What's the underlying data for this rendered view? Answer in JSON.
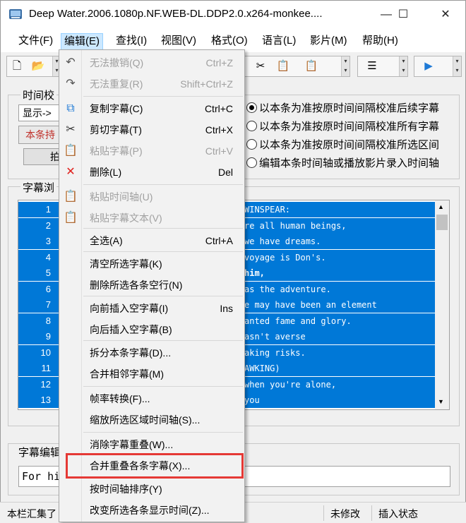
{
  "window": {
    "title": "Deep Water.2006.1080p.NF.WEB-DL.DDP2.0.x264-monkee....",
    "minimize_glyph": "—",
    "maximize_glyph": "☐",
    "close_glyph": "✕"
  },
  "menubar": {
    "items": [
      "文件(F)",
      "编辑(E)",
      "查找(I)",
      "视图(V)",
      "格式(O)",
      "语言(L)",
      "影片(M)",
      "帮助(H)"
    ]
  },
  "left_panel": {
    "group_label": "时间校",
    "display_button": "显示->",
    "red_button": "本条持",
    "small_button": "拍"
  },
  "radios": [
    {
      "label": "以本条为准按原时间间隔校准后续字幕",
      "checked": true
    },
    {
      "label": "以本条为准按原时间间隔校准所有字幕",
      "checked": false
    },
    {
      "label": "以本条为准按原时间间隔校准所选区间",
      "checked": false
    },
    {
      "label": "编辑本条时间轴或播放影片录入时间轴",
      "checked": false
    }
  ],
  "subtitle_browser": {
    "label": "字幕浏",
    "rows": [
      {
        "num": "1",
        "text": "WINSPEAR:",
        "bold": false
      },
      {
        "num": "2",
        "text": "re all human beings,",
        "bold": false
      },
      {
        "num": "3",
        "text": "we have dreams.",
        "bold": false
      },
      {
        "num": "4",
        "text": " voyage is Don's.",
        "bold": false
      },
      {
        "num": "5",
        "text": " him,",
        "bold": true
      },
      {
        "num": "6",
        "text": "as the adventure.",
        "bold": false
      },
      {
        "num": "7",
        "text": "e may have been an element",
        "bold": false
      },
      {
        "num": "8",
        "text": "anted fame and glory.",
        "bold": false
      },
      {
        "num": "9",
        "text": "asn't averse",
        "bold": false
      },
      {
        "num": "10",
        "text": "aking risks.",
        "bold": false
      },
      {
        "num": "11",
        "text": "AWKING)",
        "bold": false
      },
      {
        "num": "12",
        "text": " when you're alone,",
        "bold": false
      },
      {
        "num": "13",
        "text": " you",
        "bold": false
      }
    ]
  },
  "editor": {
    "label": "字幕编辑",
    "text": "For hi"
  },
  "statusbar": {
    "left": "本栏汇集了",
    "modified": "未修改",
    "mode": "插入状态"
  },
  "edit_menu": {
    "items": [
      {
        "label": "无法撤销(Q)",
        "shortcut": "Ctrl+Z",
        "disabled": true,
        "icon": "undo-icon"
      },
      {
        "label": "无法重复(R)",
        "shortcut": "Shift+Ctrl+Z",
        "disabled": true,
        "icon": "redo-icon"
      },
      {
        "label": "复制字幕(C)",
        "shortcut": "Ctrl+C",
        "disabled": false,
        "icon": "copy-icon"
      },
      {
        "label": "剪切字幕(T)",
        "shortcut": "Ctrl+X",
        "disabled": false,
        "icon": "cut-icon"
      },
      {
        "label": "粘贴字幕(P)",
        "shortcut": "Ctrl+V",
        "disabled": true,
        "icon": "paste-icon"
      },
      {
        "label": "删除(L)",
        "shortcut": "Del",
        "disabled": false,
        "icon": "delete-icon"
      },
      {
        "label": "粘贴时间轴(U)",
        "shortcut": "",
        "disabled": true,
        "icon": "paste-timeline-icon"
      },
      {
        "label": "粘贴字幕文本(V)",
        "shortcut": "",
        "disabled": true,
        "icon": "paste-text-icon"
      },
      {
        "label": "全选(A)",
        "shortcut": "Ctrl+A",
        "disabled": false,
        "icon": ""
      },
      {
        "label": "清空所选字幕(K)",
        "shortcut": "",
        "disabled": false,
        "icon": ""
      },
      {
        "label": "删除所选各条空行(N)",
        "shortcut": "",
        "disabled": false,
        "icon": ""
      },
      {
        "label": "向前插入空字幕(I)",
        "shortcut": "Ins",
        "disabled": false,
        "icon": ""
      },
      {
        "label": "向后插入空字幕(B)",
        "shortcut": "",
        "disabled": false,
        "icon": ""
      },
      {
        "label": "拆分本条字幕(D)...",
        "shortcut": "",
        "disabled": false,
        "icon": ""
      },
      {
        "label": "合并相邻字幕(M)",
        "shortcut": "",
        "disabled": false,
        "icon": ""
      },
      {
        "label": "帧率转换(F)...",
        "shortcut": "",
        "disabled": false,
        "icon": ""
      },
      {
        "label": "缩放所选区域时间轴(S)...",
        "shortcut": "",
        "disabled": false,
        "icon": ""
      },
      {
        "label": "消除字幕重叠(W)...",
        "shortcut": "",
        "disabled": false,
        "icon": ""
      },
      {
        "label": "合并重叠各条字幕(X)...",
        "shortcut": "",
        "disabled": false,
        "icon": ""
      },
      {
        "label": "按时间轴排序(Y)",
        "shortcut": "",
        "disabled": false,
        "icon": ""
      },
      {
        "label": "改变所选各条显示时间(Z)...",
        "shortcut": "",
        "disabled": false,
        "icon": ""
      }
    ]
  },
  "colors": {
    "selection": "#0078d7",
    "menu_highlight": "#e53935",
    "delete_icon": "#e0201c",
    "accent": "#1f7ad6"
  }
}
